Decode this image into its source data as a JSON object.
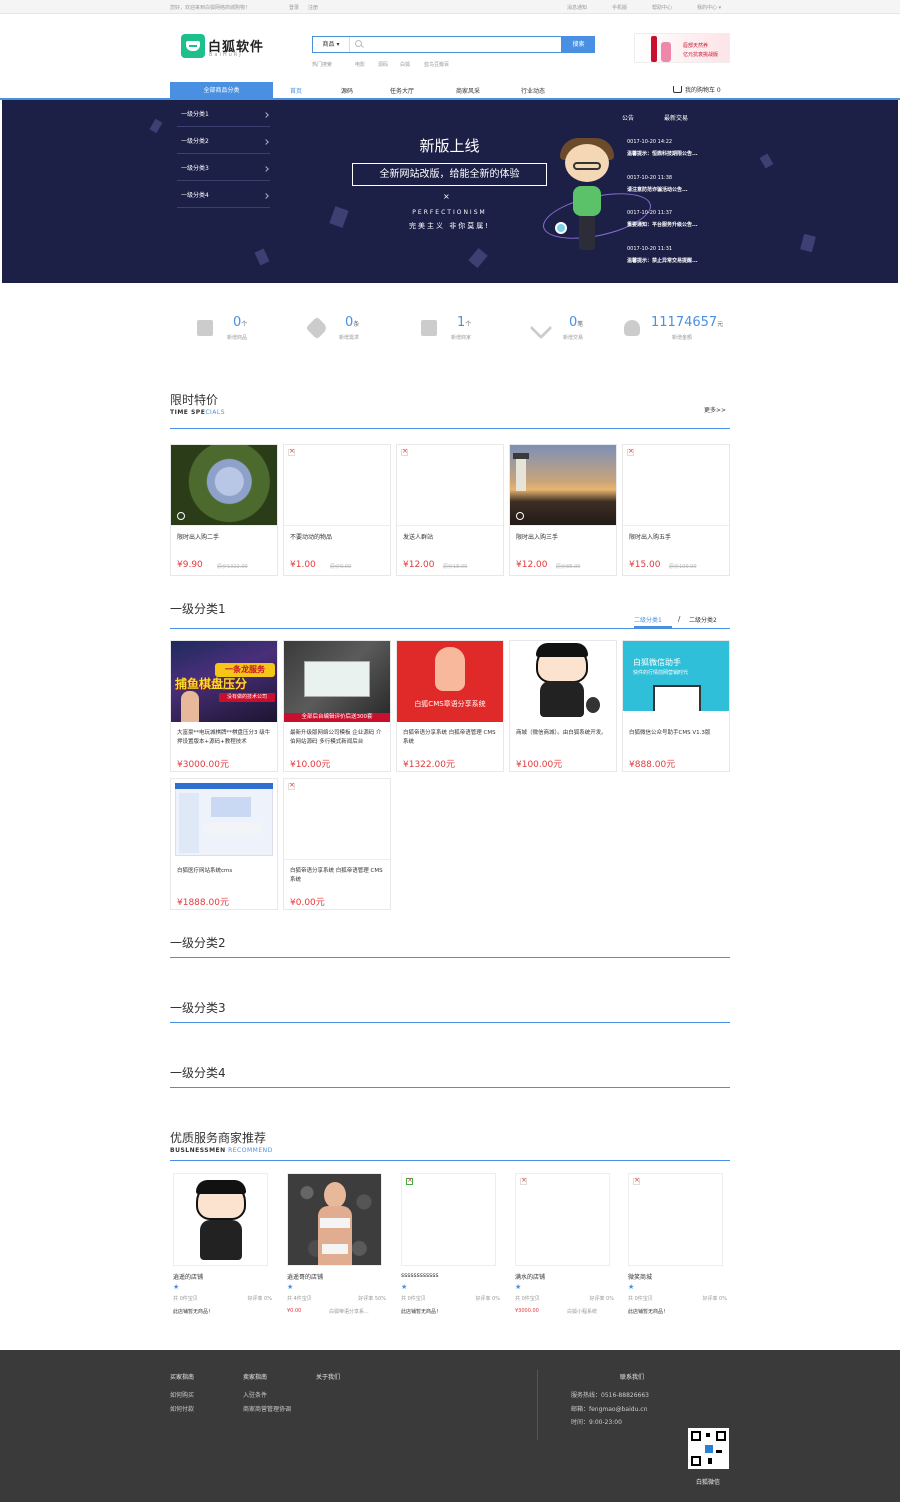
{
  "topbar": {
    "welcome": "您好，欢迎来到白狐网络商城购物！",
    "login": "登录",
    "register": "注册",
    "links": [
      "消息通知",
      "手机版",
      "帮助中心",
      "我的中心 ▾"
    ]
  },
  "logo": {
    "text": "白狐软件",
    "sub": "BaiHuRJ"
  },
  "search": {
    "category": "商品 ▾",
    "placeholder": "",
    "button": "搜索",
    "hot_label": "热门搜索",
    "hot": [
      "电影",
      "源码",
      "白狐",
      "蓝鸟豆瓣百"
    ]
  },
  "ad": {
    "line1": "唇部天然养",
    "line2": "亿元抗衰挑战版"
  },
  "nav": {
    "all": "全部商品分类",
    "items": [
      "首页",
      "源码",
      "任务大厅",
      "商家风采",
      "行业动态"
    ],
    "cart": "我的购物车 0"
  },
  "banner": {
    "categories": [
      "一级分类1",
      "一级分类2",
      "一级分类3",
      "一级分类4"
    ],
    "title": "新版上线",
    "box": "全新网站改版，给能全新的体验",
    "x": "×",
    "en": "PERFECTIONISM",
    "cn": "完美主义  非你莫属!",
    "tabs": [
      "公告",
      "最新交易"
    ],
    "notices": [
      {
        "date": "0017-10-20 14:22",
        "title": "温馨提示：恒鼎科技期限公告..."
      },
      {
        "date": "0017-10-20 11:38",
        "title": "请注意防范诈骗活动公告..."
      },
      {
        "date": "0017-10-20 11:37",
        "title": "重要通知：平台服务升级公告..."
      },
      {
        "date": "0017-10-20 11:31",
        "title": "温馨提示：禁止异常交易提醒..."
      }
    ]
  },
  "stats": [
    {
      "num": "0",
      "unit": "个",
      "label": "新增商品"
    },
    {
      "num": "0",
      "unit": "条",
      "label": "新增需求"
    },
    {
      "num": "1",
      "unit": "个",
      "label": "新增商家"
    },
    {
      "num": "0",
      "unit": "笔",
      "label": "新增交易"
    },
    {
      "num": "11174657",
      "unit": "元",
      "label": "新增金额"
    }
  ],
  "specials": {
    "title": "限时特价",
    "en_bold": "TIME SPE",
    "en_rest": "CIALS",
    "more": "更多>>",
    "items": [
      {
        "name": "限时出入购二手",
        "price": "¥9.90",
        "old": "原价1322.00"
      },
      {
        "name": "不要动动的物品",
        "price": "¥1.00",
        "old": "原价9.00"
      },
      {
        "name": "发送人群站",
        "price": "¥12.00",
        "old": "原价18.00"
      },
      {
        "name": "限时出入购三手",
        "price": "¥12.00",
        "old": "原价88.00"
      },
      {
        "name": "限时出入购五手",
        "price": "¥15.00",
        "old": "原价100.00"
      }
    ]
  },
  "cat1": {
    "title": "一级分类1",
    "tabs": [
      "二级分类1",
      "/",
      "二级分类2"
    ],
    "items": [
      {
        "name": "大富豪**电玩城棋牌**棋盘压分3 级牛押设置版本+源码+教程技术",
        "price": "¥3000.00",
        "unit": "元"
      },
      {
        "name": "最新升级版网络公司模板 企业源码 介伯网站源码 多行模式新闻后台",
        "price": "¥10.00",
        "unit": "元"
      },
      {
        "name": "白狐帝语分享系统 白狐帝语管理 CMS系统",
        "price": "¥1322.00",
        "unit": "元"
      },
      {
        "name": "商城（微信商城）。由白狐系统开发。",
        "price": "¥100.00",
        "unit": "元"
      },
      {
        "name": "白狐微信公众号助手CMS V1.3版",
        "price": "¥888.00",
        "unit": "元"
      },
      {
        "name": "白狐医疗网站系统cms",
        "price": "¥1888.00",
        "unit": "元"
      },
      {
        "name": "白狐帝语分享系统 白狐帝语管理 CMS系统",
        "price": "¥0.00",
        "unit": "元"
      }
    ],
    "img_texts": {
      "i1_top": "一条龙服务",
      "i1_main": "捕鱼棋盘压分",
      "i1_sub": "没有做的技术公司",
      "i2_band": "全部后台编辑评价后送300套",
      "i3_title": "白狐CMS章语分享系统",
      "i5_title": "白狐微信助手",
      "i5_sub": "快件的行情前网营销时代"
    }
  },
  "cat2": {
    "title": "一级分类2"
  },
  "cat3": {
    "title": "一级分类3"
  },
  "cat4": {
    "title": "一级分类4"
  },
  "merchants": {
    "title": "优质服务商家推荐",
    "en_bold": "BUSLNESSMEN",
    "en_rest": " RECOMMEND",
    "items": [
      {
        "name": "逍遥的店铺",
        "count": "共 0件宝贝",
        "rate": "好评率 0%",
        "bottom": "此店铺暂无商品！",
        "price": ""
      },
      {
        "name": "逍遥哥的店铺",
        "count": "共 4件宝贝",
        "rate": "好评率 50%",
        "bottom": "白狐帝语分享系...",
        "price": "¥0.00"
      },
      {
        "name": "ssssssssssss",
        "count": "共 0件宝贝",
        "rate": "好评率 0%",
        "bottom": "此店铺暂无商品！",
        "price": ""
      },
      {
        "name": "满水的店铺",
        "count": "共 0件宝贝",
        "rate": "好评率 0%",
        "bottom": "白狐小程系统",
        "price": "¥3000.00"
      },
      {
        "name": "微笑商城",
        "count": "共 0件宝贝",
        "rate": "好评率 0%",
        "bottom": "此店铺暂无商品！",
        "price": ""
      }
    ]
  },
  "footer": {
    "col1": [
      "买家指南",
      "如何购买",
      "如何付款"
    ],
    "col2": [
      "卖家指南",
      "入驻条件",
      "商家商营管理协调"
    ],
    "col3": [
      "关于我们"
    ],
    "contact_title": "联系我们",
    "phone": "服务热线：0516-88826663",
    "email": "邮箱：fengmao@baidu.cn",
    "time": "时间：9:00-23:00",
    "qr_label": "白狐微信"
  }
}
